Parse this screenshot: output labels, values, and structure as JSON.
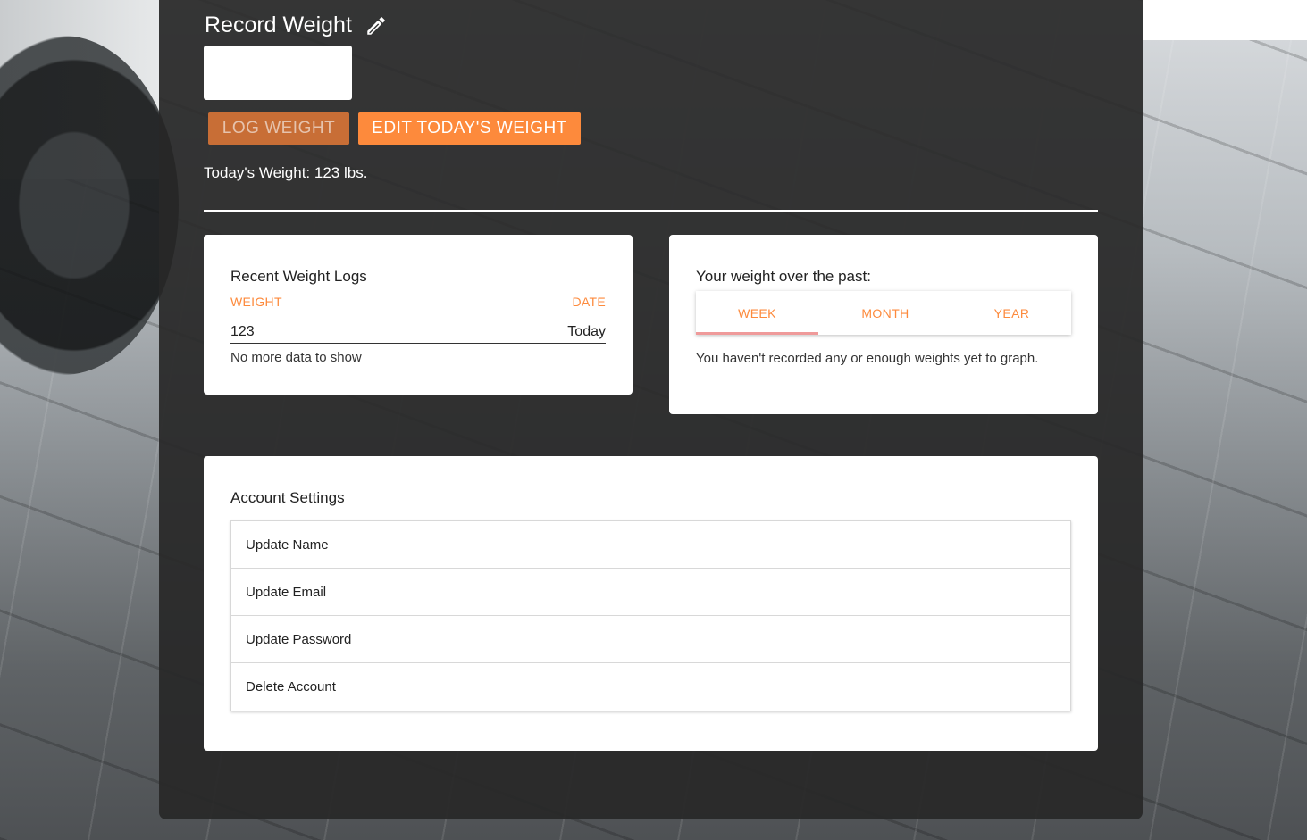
{
  "record": {
    "title": "Record Weight",
    "input_value": "",
    "log_button": "LOG WEIGHT",
    "edit_button": "EDIT TODAY'S WEIGHT",
    "today_weight": "Today's Weight: 123 lbs."
  },
  "recent_logs": {
    "title": "Recent Weight Logs",
    "columns": [
      "WEIGHT",
      "DATE"
    ],
    "rows": [
      {
        "weight": "123",
        "date": "Today"
      }
    ],
    "footer": "No more data to show"
  },
  "graph": {
    "title": "Your weight over the past:",
    "tabs": [
      {
        "label": "WEEK",
        "active": true
      },
      {
        "label": "MONTH",
        "active": false
      },
      {
        "label": "YEAR",
        "active": false
      }
    ],
    "message": "You haven't recorded any or enough weights yet to graph."
  },
  "account": {
    "title": "Account Settings",
    "items": [
      "Update Name",
      "Update Email",
      "Update Password",
      "Delete Account"
    ]
  },
  "colors": {
    "accent": "#fd8a3c",
    "accent_dim": "#c86e36",
    "panel": "#282828",
    "tab_indicator": "#ef9a9a"
  }
}
